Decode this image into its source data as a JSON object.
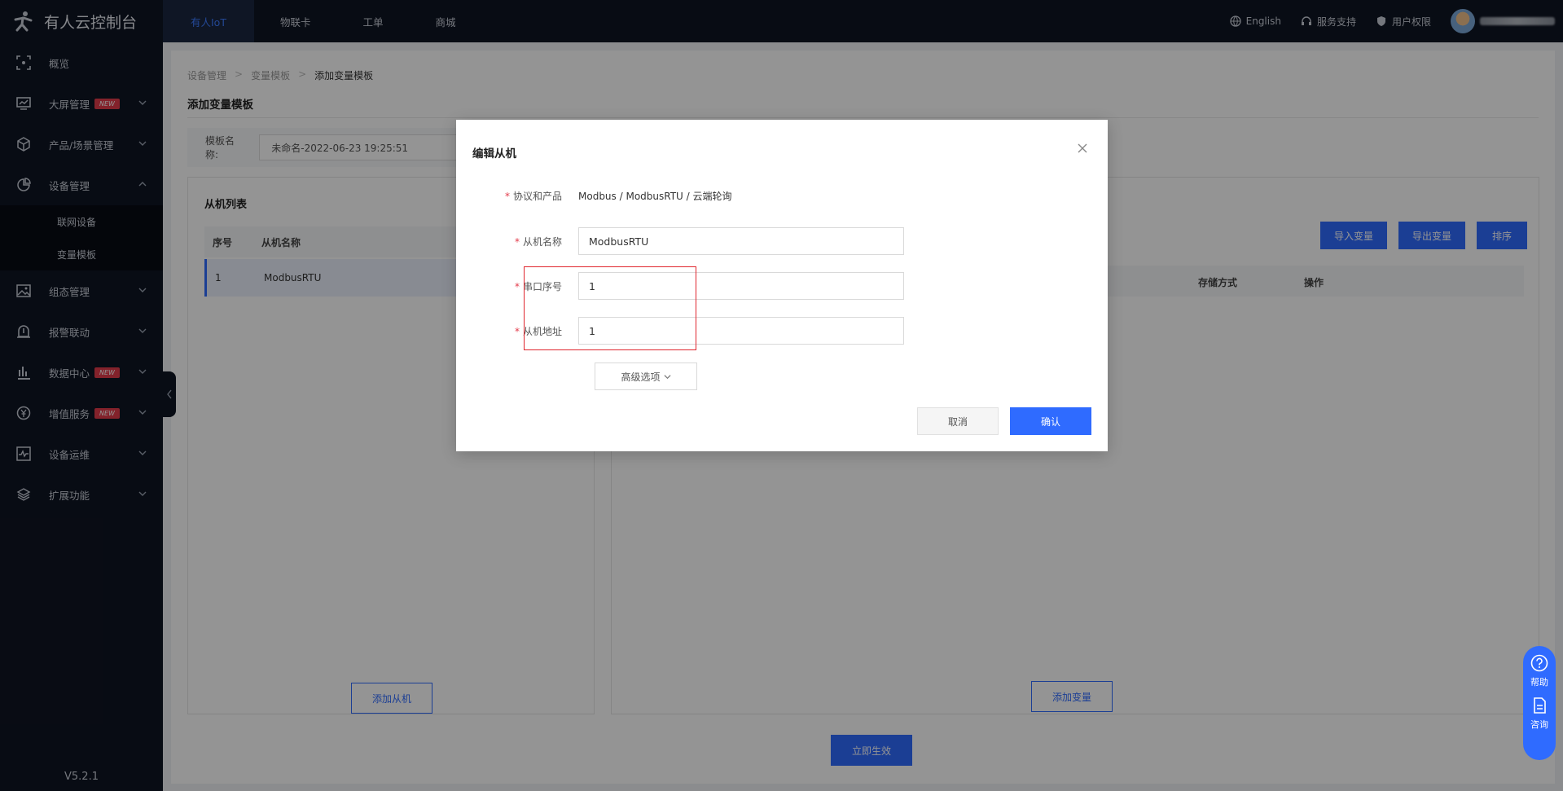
{
  "app": {
    "title": "有人云控制台",
    "version": "V5.2.1"
  },
  "sidebar": {
    "items": [
      {
        "label": "概览",
        "icon": "overview-icon",
        "new": false,
        "expandable": false
      },
      {
        "label": "大屏管理",
        "icon": "screen-icon",
        "new": true,
        "expandable": true
      },
      {
        "label": "产品/场景管理",
        "icon": "cube-icon",
        "new": false,
        "expandable": true
      },
      {
        "label": "设备管理",
        "icon": "pie-icon",
        "new": false,
        "expandable": true,
        "expanded": true
      },
      {
        "label": "组态管理",
        "icon": "image-icon",
        "new": false,
        "expandable": true
      },
      {
        "label": "报警联动",
        "icon": "alarm-icon",
        "new": false,
        "expandable": true
      },
      {
        "label": "数据中心",
        "icon": "chart-icon",
        "new": true,
        "expandable": true
      },
      {
        "label": "增值服务",
        "icon": "yen-icon",
        "new": true,
        "expandable": true
      },
      {
        "label": "设备运维",
        "icon": "pulse-icon",
        "new": false,
        "expandable": true
      },
      {
        "label": "扩展功能",
        "icon": "layers-icon",
        "new": false,
        "expandable": true
      }
    ],
    "sub_items": [
      "联网设备",
      "变量模板"
    ],
    "new_badge": "NEW"
  },
  "topnav": {
    "items": [
      "有人IoT",
      "物联卡",
      "工单",
      "商城"
    ],
    "active": "有人IoT",
    "right": {
      "language": "English",
      "support": "服务支持",
      "permissions": "用户权限"
    }
  },
  "page": {
    "breadcrumb": [
      "设备管理",
      "变量模板",
      "添加变量模板"
    ],
    "title": "添加变量模板",
    "template_label": "模板名称:",
    "template_value": "未命名-2022-06-23 19:25:51",
    "slave_list_title": "从机列表",
    "slave_cols": [
      "序号",
      "从机名称"
    ],
    "slave_rows": [
      {
        "no": "1",
        "name": "ModbusRTU"
      }
    ],
    "add_slave": "添加从机",
    "import_var": "导入变量",
    "export_var": "导出变量",
    "sort": "排序",
    "var_cols": [
      "存储方式",
      "操作"
    ],
    "add_var": "添加变量",
    "apply": "立即生效"
  },
  "help": {
    "help": "帮助",
    "consult": "咨询"
  },
  "modal": {
    "title": "编辑从机",
    "protocol_label": "协议和产品",
    "protocol_value": "Modbus / ModbusRTU / 云端轮询",
    "name_label": "从机名称",
    "name_value": "ModbusRTU",
    "serial_label": "串口序号",
    "serial_value": "1",
    "address_label": "从机地址",
    "address_value": "1",
    "advanced": "高级选项",
    "cancel": "取消",
    "confirm": "确认"
  },
  "colors": {
    "primary": "#2f6bff",
    "sidebar": "#0f1523",
    "danger": "#e0262e"
  }
}
